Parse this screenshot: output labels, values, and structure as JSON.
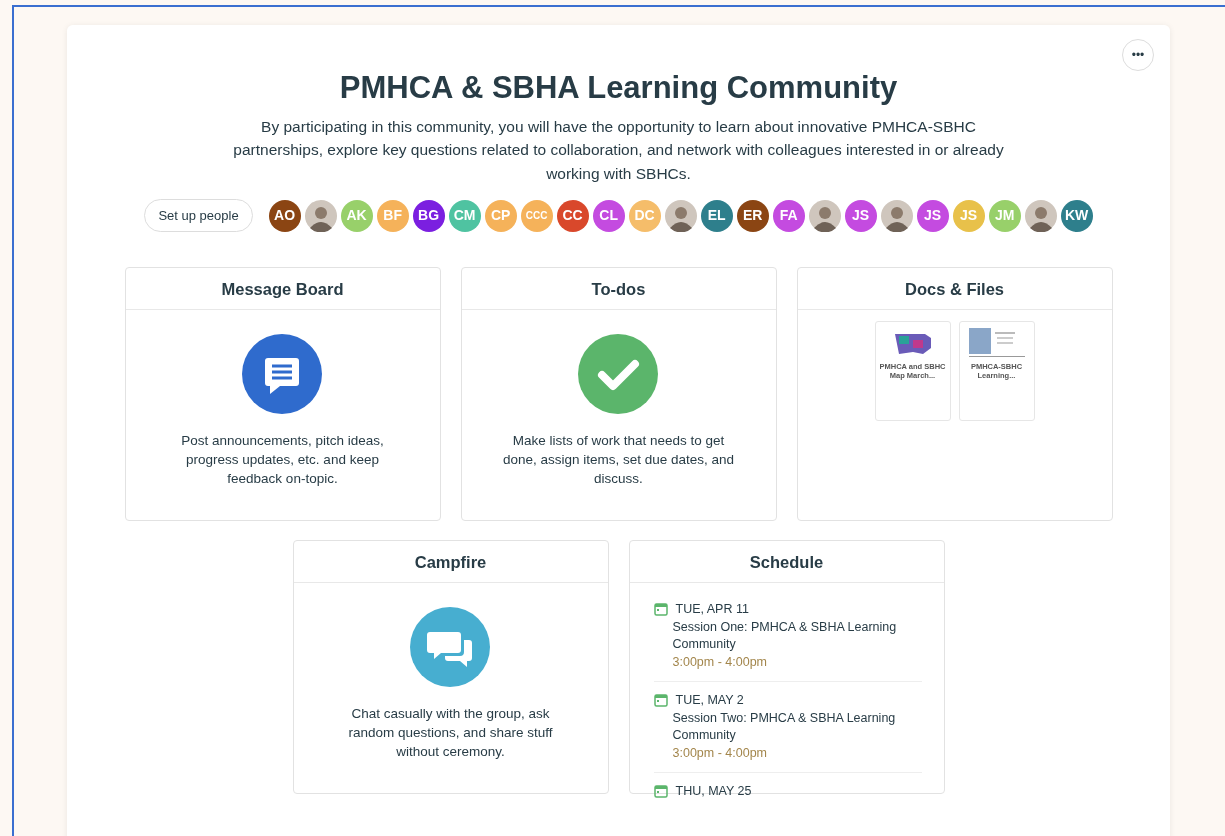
{
  "menu_button": "•••",
  "title": "PMHCA & SBHA Learning Community",
  "description": "By participating in this community, you will have the opportunity to learn about innovative PMHCA-SBHC partnerships, explore key questions related to collaboration, and network with colleagues interested in or already working with SBHCs.",
  "setup_button": "Set up people",
  "people": [
    {
      "kind": "initials",
      "initials": "AO",
      "color": "#8b4513"
    },
    {
      "kind": "photo"
    },
    {
      "kind": "initials",
      "initials": "AK",
      "color": "#98d06a"
    },
    {
      "kind": "initials",
      "initials": "BF",
      "color": "#f5b25a"
    },
    {
      "kind": "initials",
      "initials": "BG",
      "color": "#7b1fe0"
    },
    {
      "kind": "initials",
      "initials": "CM",
      "color": "#4fc3a1"
    },
    {
      "kind": "initials",
      "initials": "CP",
      "color": "#f5b25a"
    },
    {
      "kind": "initials",
      "initials": "CCC",
      "color": "#f5b25a"
    },
    {
      "kind": "initials",
      "initials": "CC",
      "color": "#d9482b"
    },
    {
      "kind": "initials",
      "initials": "CL",
      "color": "#c44be0"
    },
    {
      "kind": "initials",
      "initials": "DC",
      "color": "#f5bd6a"
    },
    {
      "kind": "photo"
    },
    {
      "kind": "initials",
      "initials": "EL",
      "color": "#2e7f8c"
    },
    {
      "kind": "initials",
      "initials": "ER",
      "color": "#8b4513"
    },
    {
      "kind": "initials",
      "initials": "FA",
      "color": "#c44be0"
    },
    {
      "kind": "photo"
    },
    {
      "kind": "initials",
      "initials": "JS",
      "color": "#c44be0"
    },
    {
      "kind": "photo"
    },
    {
      "kind": "initials",
      "initials": "JS",
      "color": "#c44be0"
    },
    {
      "kind": "initials",
      "initials": "JS",
      "color": "#e8c14a"
    },
    {
      "kind": "initials",
      "initials": "JM",
      "color": "#98d06a"
    },
    {
      "kind": "photo"
    },
    {
      "kind": "initials",
      "initials": "KW",
      "color": "#2e7f8c"
    }
  ],
  "tools": [
    {
      "kind": "message_board",
      "title": "Message Board",
      "description": "Post announcements, pitch ideas, progress updates, etc. and keep feedback on-topic."
    },
    {
      "kind": "todos",
      "title": "To-dos",
      "description": "Make lists of work that needs to get done, assign items, set due dates, and discuss."
    },
    {
      "kind": "docs",
      "title": "Docs & Files",
      "files": [
        {
          "kind": "map",
          "name": "PMHCA and SBHC Map March..."
        },
        {
          "kind": "photo",
          "name": "PMHCA-SBHC Learning..."
        }
      ]
    },
    {
      "kind": "campfire",
      "title": "Campfire",
      "description": "Chat casually with the group, ask random questions, and share stuff without ceremony."
    },
    {
      "kind": "schedule",
      "title": "Schedule",
      "events": [
        {
          "date": "TUE, APR 11",
          "title": "Session One: PMHCA & SBHA Learning Community",
          "time": "3:00pm - 4:00pm"
        },
        {
          "date": "TUE, MAY 2",
          "title": "Session Two: PMHCA & SBHA Learning Community",
          "time": "3:00pm - 4:00pm"
        },
        {
          "date": "THU, MAY 25"
        }
      ]
    }
  ]
}
